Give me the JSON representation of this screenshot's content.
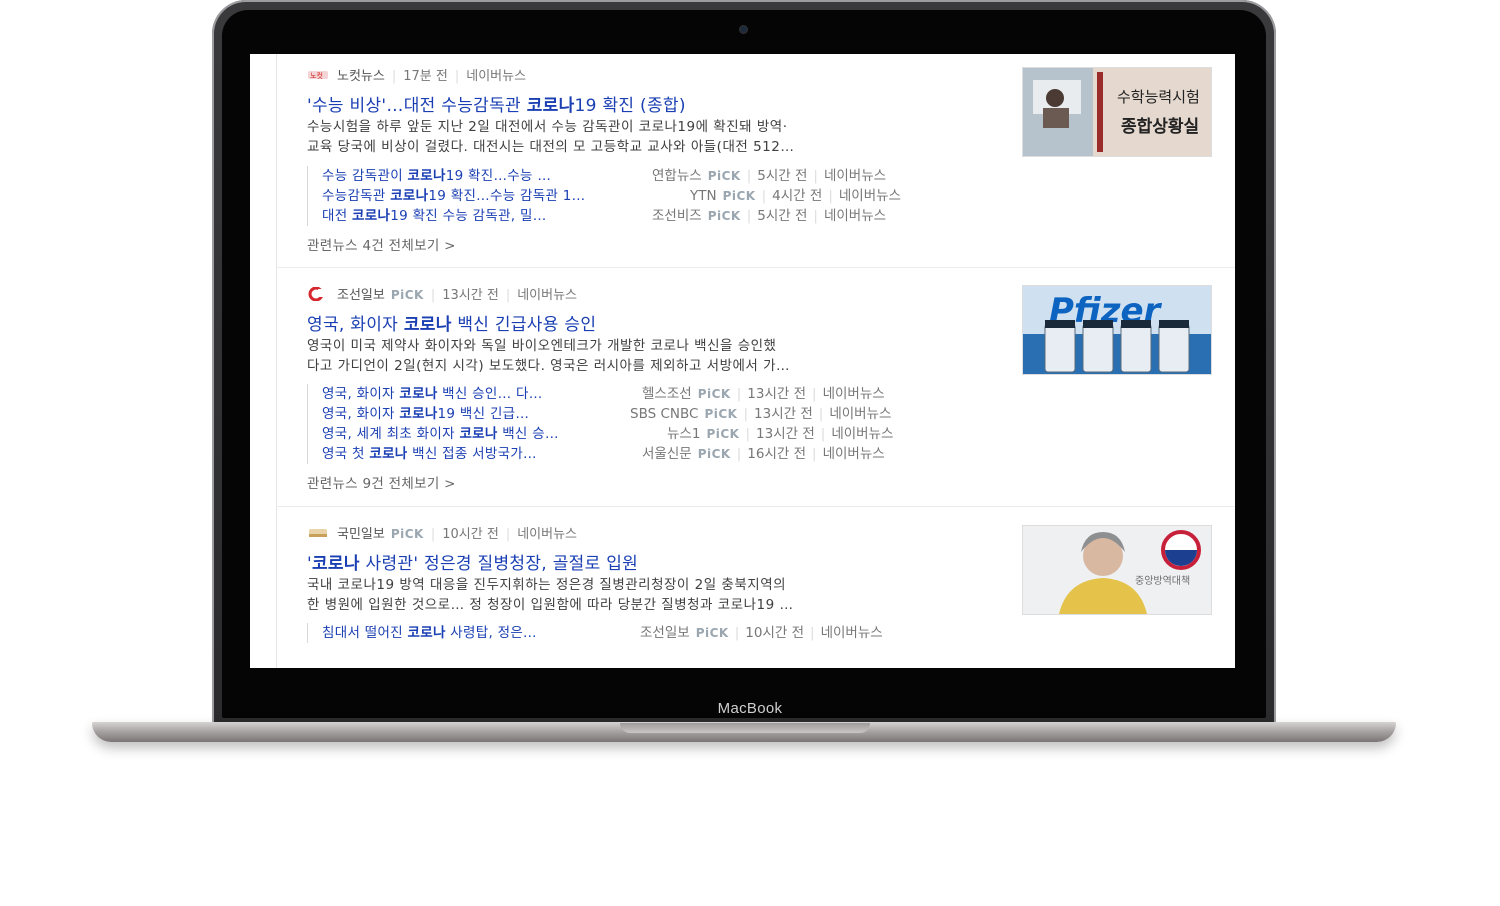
{
  "device": {
    "brand": "MacBook"
  },
  "news": [
    {
      "press": "노컷뉴스",
      "time": "17분 전",
      "source": "네이버뉴스",
      "title_pre": "'수능 비상'…대전 수능감독관 ",
      "title_kw": "코로나",
      "title_post": "19 확진 (종합)",
      "desc_line1": "수능시험을 하루 앞둔 지난 2일 대전에서 수능 감독관이 코로나19에 확진돼 방역·",
      "desc_line2": "교육 당국에 비상이 걸렸다. 대전시는 대전의 모 고등학교 교사와 아들(대전 512…",
      "related": [
        {
          "pre": "수능 감독관이 ",
          "kw": "코로나",
          "post": "19 확진…수능 …",
          "press": "연합뉴스",
          "pick": "PiCK",
          "time": "5시간 전",
          "source": "네이버뉴스"
        },
        {
          "pre": "수능감독관 ",
          "kw": "코로나",
          "post": "19 확진…수능 감독관 1…",
          "press": "YTN",
          "pick": "PiCK",
          "time": "4시간 전",
          "source": "네이버뉴스"
        },
        {
          "pre": "대전 ",
          "kw": "코로나",
          "post": "19 확진 수능 감독관, 밀…",
          "press": "조선비즈",
          "pick": "PiCK",
          "time": "5시간 전",
          "source": "네이버뉴스"
        }
      ],
      "more": "관련뉴스 4건 전체보기 >",
      "thumb_text1": "수학능력시험",
      "thumb_text2": "종합상황실"
    },
    {
      "press": "조선일보",
      "pick": "PiCK",
      "time": "13시간 전",
      "source": "네이버뉴스",
      "title_pre": "영국, 화이자 ",
      "title_kw": "코로나",
      "title_post": " 백신 긴급사용 승인",
      "desc_line1": "영국이 미국 제약사 화이자와 독일 바이오엔테크가 개발한 코로나 백신을 승인했",
      "desc_line2": "다고 가디언이 2일(현지 시각) 보도했다. 영국은 러시아를 제외하고 서방에서 가…",
      "related": [
        {
          "pre": "영국, 화이자 ",
          "kw": "코로나",
          "post": " 백신 승인… 다…",
          "press": "헬스조선",
          "pick": "PiCK",
          "time": "13시간 전",
          "source": "네이버뉴스"
        },
        {
          "pre": "영국, 화이자 ",
          "kw": "코로나",
          "post": "19 백신 긴급…",
          "press": "SBS CNBC",
          "pick": "PiCK",
          "time": "13시간 전",
          "source": "네이버뉴스"
        },
        {
          "pre": "영국, 세계 최초 화이자 ",
          "kw": "코로나",
          "post": " 백신 승…",
          "press": "뉴스1",
          "pick": "PiCK",
          "time": "13시간 전",
          "source": "네이버뉴스"
        },
        {
          "pre": "영국 첫 ",
          "kw": "코로나",
          "post": " 백신 접종 서방국가…",
          "press": "서울신문",
          "pick": "PiCK",
          "time": "16시간 전",
          "source": "네이버뉴스"
        }
      ],
      "more": "관련뉴스 9건 전체보기 >",
      "thumb_text1": "Pfizer"
    },
    {
      "press": "국민일보",
      "pick": "PiCK",
      "time": "10시간 전",
      "source": "네이버뉴스",
      "title_pre": "'",
      "title_kw": "코로나",
      "title_post": " 사령관' 정은경 질병청장, 골절로 입원",
      "desc_line1": "국내 코로나19 방역 대응을 진두지휘하는 정은경 질병관리청장이 2일 충북지역의",
      "desc_line2": "한 병원에 입원한 것으로… 정 청장이 입원함에 따라 당분간 질병청과 코로나19 …",
      "related": [
        {
          "pre": "침대서 떨어진 ",
          "kw": "코로나",
          "post": " 사령탑, 정은…",
          "press": "조선일보",
          "pick": "PiCK",
          "time": "10시간 전",
          "source": "네이버뉴스"
        }
      ],
      "thumb_text1": "중앙방역대책"
    }
  ]
}
